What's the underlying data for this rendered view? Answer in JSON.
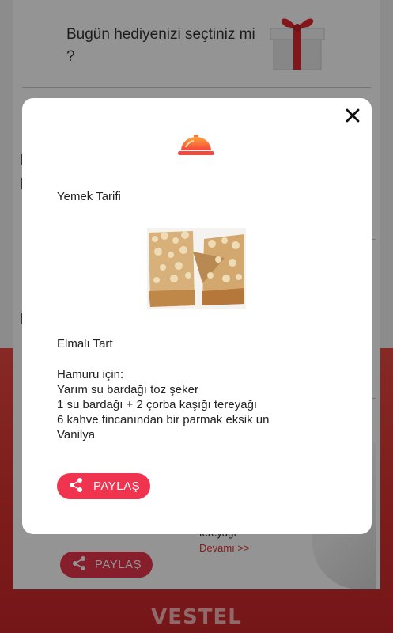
{
  "background": {
    "gift_question": "Bugün hediyenizi seçtiniz mi ?",
    "partial_text": "tereyağı",
    "more_link": "Devamı >>",
    "share_label": "PAYLAŞ",
    "brand": "VESTEL"
  },
  "modal": {
    "heading": "Yemek Tarifi",
    "recipe_title": "Elmalı Tart",
    "recipe_lines": [
      "Hamuru için:",
      "Yarım su bardağı toz şeker",
      "1 su bardağı + 2 çorba kaşığı tereyağı",
      "6 kahve fincanından bir parmak eksik un",
      "Vanilya"
    ],
    "share_label": "PAYLAŞ",
    "icons": {
      "close": "close-icon",
      "dish": "serving-dish-icon",
      "share": "share-icon"
    }
  },
  "colors": {
    "accent": "#f0334f",
    "background_red": "#d7312e",
    "link": "#e5302f"
  }
}
